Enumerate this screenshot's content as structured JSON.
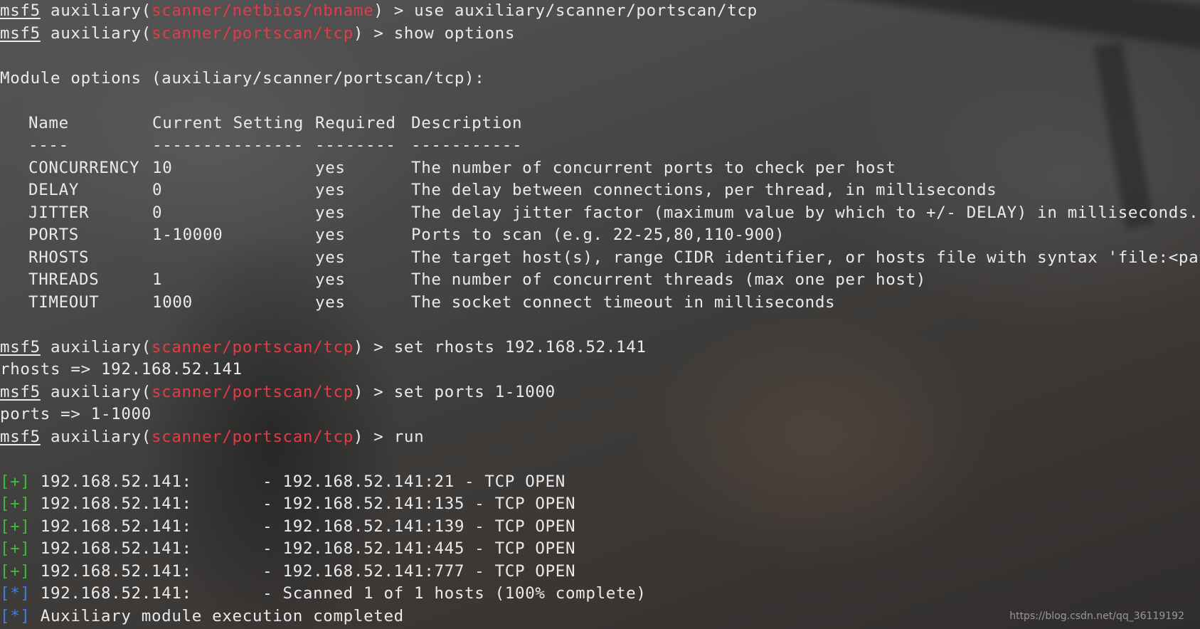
{
  "prompt": {
    "name": "msf5",
    "prefix": " auxiliary(",
    "suffix": ") > "
  },
  "commands": [
    {
      "module": "scanner/netbios/nbname",
      "command": "use auxiliary/scanner/portscan/tcp"
    },
    {
      "module": "scanner/portscan/tcp",
      "command": "show options"
    },
    {
      "module": "scanner/portscan/tcp",
      "command": "set rhosts 192.168.52.141"
    },
    {
      "module": "scanner/portscan/tcp",
      "command": "set ports 1-1000"
    },
    {
      "module": "scanner/portscan/tcp",
      "command": "run"
    }
  ],
  "module_options": {
    "heading": "Module options (auxiliary/scanner/portscan/tcp):",
    "headers": {
      "name": "Name",
      "setting": "Current Setting",
      "required": "Required",
      "description": "Description"
    },
    "underlines": {
      "name": "----",
      "setting": "---------------",
      "required": "--------",
      "description": "-----------"
    },
    "rows": [
      {
        "name": "CONCURRENCY",
        "setting": "10",
        "required": "yes",
        "description": "The number of concurrent ports to check per host"
      },
      {
        "name": "DELAY",
        "setting": "0",
        "required": "yes",
        "description": "The delay between connections, per thread, in milliseconds"
      },
      {
        "name": "JITTER",
        "setting": "0",
        "required": "yes",
        "description": "The delay jitter factor (maximum value by which to +/- DELAY) in milliseconds."
      },
      {
        "name": "PORTS",
        "setting": "1-10000",
        "required": "yes",
        "description": "Ports to scan (e.g. 22-25,80,110-900)"
      },
      {
        "name": "RHOSTS",
        "setting": "",
        "required": "yes",
        "description": "The target host(s), range CIDR identifier, or hosts file with syntax 'file:<path>'"
      },
      {
        "name": "THREADS",
        "setting": "1",
        "required": "yes",
        "description": "The number of concurrent threads (max one per host)"
      },
      {
        "name": "TIMEOUT",
        "setting": "1000",
        "required": "yes",
        "description": "The socket connect timeout in milliseconds"
      }
    ]
  },
  "set_outputs": {
    "rhosts": "rhosts => 192.168.52.141",
    "ports": "ports => 1-1000"
  },
  "results": [
    {
      "tag": "[+]",
      "text": " 192.168.52.141:       - 192.168.52.141:21 - TCP OPEN"
    },
    {
      "tag": "[+]",
      "text": " 192.168.52.141:       - 192.168.52.141:135 - TCP OPEN"
    },
    {
      "tag": "[+]",
      "text": " 192.168.52.141:       - 192.168.52.141:139 - TCP OPEN"
    },
    {
      "tag": "[+]",
      "text": " 192.168.52.141:       - 192.168.52.141:445 - TCP OPEN"
    },
    {
      "tag": "[+]",
      "text": " 192.168.52.141:       - 192.168.52.141:777 - TCP OPEN"
    },
    {
      "tag": "[*]",
      "text": " 192.168.52.141:       - Scanned 1 of 1 hosts (100% complete)"
    },
    {
      "tag": "[*]",
      "text": " Auxiliary module execution completed"
    }
  ],
  "watermark": "https://blog.csdn.net/qq_36119192",
  "colors": {
    "text": "#eaeaea",
    "module": "#e53b47",
    "plus_tag": "#3dbb3d",
    "star_tag": "#3e7fe0"
  }
}
